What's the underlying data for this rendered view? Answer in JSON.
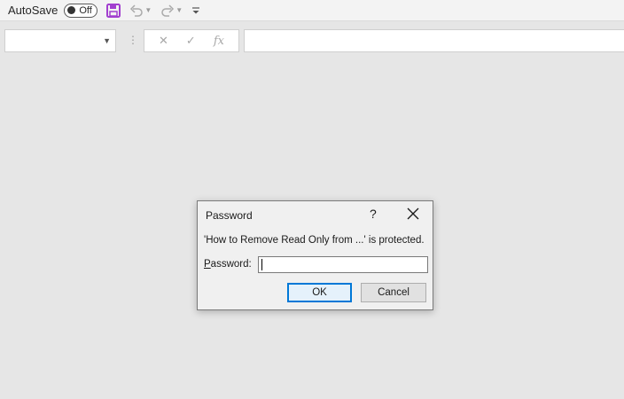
{
  "qat": {
    "autosave_label": "AutoSave",
    "autosave_state": "Off",
    "icons": [
      "save-icon",
      "undo-icon",
      "redo-icon",
      "customize-toolbar-icon"
    ],
    "save_color": "#a23fcf"
  },
  "formula_bar": {
    "name_box_value": "",
    "cancel_glyph": "✕",
    "enter_glyph": "✓",
    "function_glyph": "fx",
    "formula_value": ""
  },
  "dialog": {
    "title": "Password",
    "help_glyph": "?",
    "message": "'How to Remove Read Only from ...' is protected.",
    "password_label_mnemonic": "P",
    "password_label_rest": "assword:",
    "password_value": "",
    "ok_label": "OK",
    "cancel_label": "Cancel"
  },
  "colors": {
    "background": "#e6e6e6",
    "dialog_background": "#f0f0f0",
    "accent": "#0078d7"
  }
}
